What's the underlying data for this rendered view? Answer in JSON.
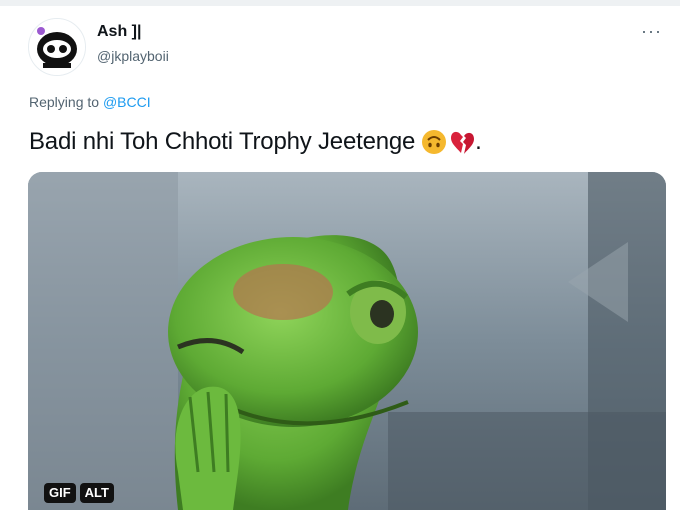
{
  "user": {
    "display_name": "Ash ]|",
    "handle": "@jkplayboii"
  },
  "more_label": "···",
  "reply": {
    "prefix": "Replying to",
    "mention": "@BCCI"
  },
  "tweet": {
    "text": "Badi nhi Toh Chhoti Trophy Jeetenge",
    "end_punct": "."
  },
  "media": {
    "gif_label": "GIF",
    "alt_label": "ALT"
  },
  "colors": {
    "accent": "#1d9bf0",
    "secondary_text": "#536471",
    "primary_text": "#0f1419"
  },
  "icons": [
    "upside-down-face-icon",
    "broken-heart-icon"
  ]
}
